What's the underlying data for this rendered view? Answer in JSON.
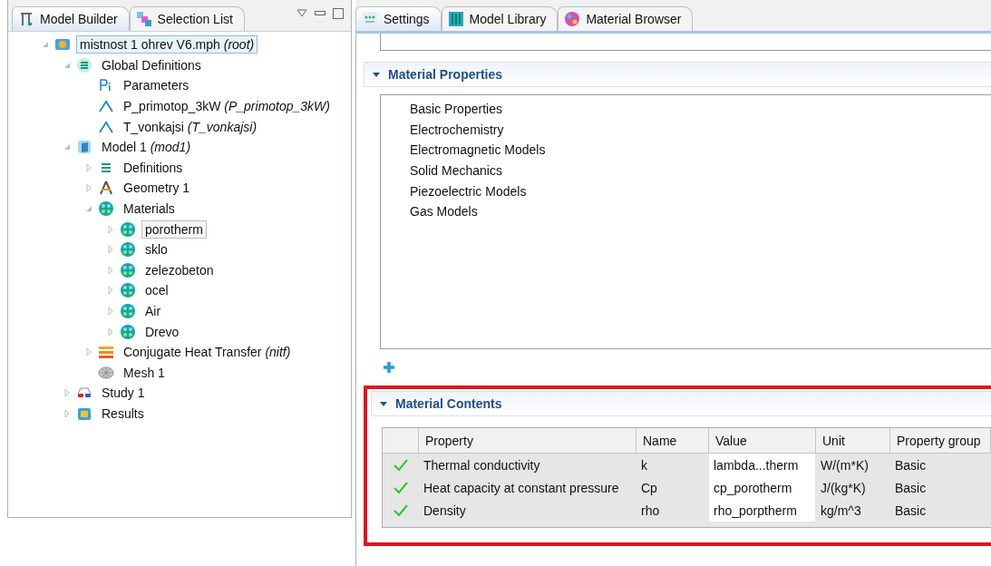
{
  "left_panel": {
    "tabs": [
      {
        "label": "Model Builder",
        "selected": true
      },
      {
        "label": "Selection List",
        "selected": false
      }
    ],
    "tree": [
      {
        "label": "mistnost 1 ohrev V6.mph *(root)*",
        "kind": "file",
        "expanded": true,
        "selected": true,
        "focused": false,
        "children": [
          {
            "label": "Global Definitions",
            "kind": "globals",
            "expanded": true,
            "selected": false,
            "focused": false,
            "children": [
              {
                "label": "Parameters",
                "kind": "parameters",
                "selected": false,
                "focused": false
              },
              {
                "label": "P_primotop_3kW *(P_primotop_3kW)*",
                "kind": "function",
                "selected": false,
                "focused": false
              },
              {
                "label": "T_vonkajsi *(T_vonkajsi)*",
                "kind": "function",
                "selected": false,
                "focused": false
              }
            ]
          },
          {
            "label": "Model 1 *(mod1)*",
            "kind": "model",
            "expanded": true,
            "selected": false,
            "focused": false,
            "children": [
              {
                "label": "Definitions",
                "kind": "definitions",
                "expanded": false,
                "selected": false,
                "focused": false
              },
              {
                "label": "Geometry 1",
                "kind": "geometry",
                "expanded": false,
                "selected": false,
                "focused": false
              },
              {
                "label": "Materials",
                "kind": "materials",
                "expanded": true,
                "selected": false,
                "focused": false,
                "children": [
                  {
                    "label": "porotherm",
                    "kind": "material",
                    "expanded": false,
                    "selected": false,
                    "focused": true
                  },
                  {
                    "label": "sklo",
                    "kind": "material",
                    "expanded": false,
                    "selected": false,
                    "focused": false
                  },
                  {
                    "label": "zelezobeton",
                    "kind": "material",
                    "expanded": false,
                    "selected": false,
                    "focused": false
                  },
                  {
                    "label": "ocel",
                    "kind": "material",
                    "expanded": false,
                    "selected": false,
                    "focused": false
                  },
                  {
                    "label": "Air",
                    "kind": "material",
                    "expanded": false,
                    "selected": false,
                    "focused": false
                  },
                  {
                    "label": "Drevo",
                    "kind": "material",
                    "expanded": false,
                    "selected": false,
                    "focused": false
                  }
                ]
              },
              {
                "label": "Conjugate Heat Transfer *(nitf)*",
                "kind": "physics",
                "expanded": false,
                "selected": false,
                "focused": false
              },
              {
                "label": "Mesh 1",
                "kind": "mesh",
                "selected": false,
                "focused": false
              }
            ]
          },
          {
            "label": "Study 1",
            "kind": "study",
            "expanded": false,
            "selected": false,
            "focused": false
          },
          {
            "label": "Results",
            "kind": "results",
            "expanded": false,
            "selected": false,
            "focused": false
          }
        ]
      }
    ]
  },
  "right_panel": {
    "tabs": [
      {
        "label": "Settings",
        "kind": "settings",
        "selected": true
      },
      {
        "label": "Model Library",
        "kind": "library",
        "selected": false
      },
      {
        "label": "Material Browser",
        "kind": "browser",
        "selected": false
      }
    ],
    "material_properties": {
      "title": "Material Properties",
      "expanded": true,
      "items": [
        "Basic Properties",
        "Electrochemistry",
        "Electromagnetic Models",
        "Solid Mechanics",
        "Piezoelectric Models",
        "Gas Models"
      ]
    },
    "material_contents": {
      "title": "Material Contents",
      "expanded": true,
      "highlighted": true,
      "columns": [
        "Property",
        "Name",
        "Value",
        "Unit",
        "Property group"
      ],
      "rows": [
        {
          "ok": true,
          "cells": [
            "Thermal conductivity",
            "k",
            "lambda...therm",
            "W/(m*K)",
            "Basic"
          ]
        },
        {
          "ok": true,
          "cells": [
            "Heat capacity at constant pressure",
            "Cp",
            "cp_porotherm",
            "J/(kg*K)",
            "Basic"
          ]
        },
        {
          "ok": true,
          "cells": [
            "Density",
            "rho",
            "rho_porptherm",
            "kg/m^3",
            "Basic"
          ]
        }
      ]
    }
  }
}
